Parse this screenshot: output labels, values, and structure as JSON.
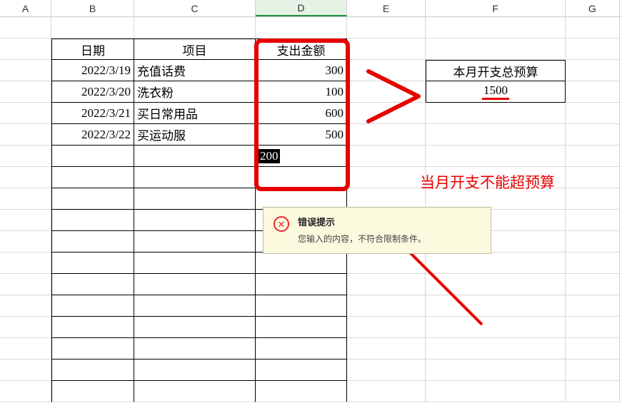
{
  "columns": [
    "A",
    "B",
    "C",
    "D",
    "E",
    "F",
    "G"
  ],
  "headers": {
    "date": "日期",
    "item": "项目",
    "amount": "支出金额"
  },
  "rows": [
    {
      "date": "2022/3/19",
      "item": "充值话费",
      "amount": "300"
    },
    {
      "date": "2022/3/20",
      "item": "洗衣粉",
      "amount": "100"
    },
    {
      "date": "2022/3/21",
      "item": "买日常用品",
      "amount": "600"
    },
    {
      "date": "2022/3/22",
      "item": "买运动服",
      "amount": "500"
    }
  ],
  "editing_value": "200",
  "budget": {
    "label": "本月开支总预算",
    "value": "1500"
  },
  "annotation": "当月开支不能超预算",
  "error": {
    "title": "错误提示",
    "message": "您输入的内容，不符合限制条件。"
  },
  "chart_data": {
    "type": "table",
    "title": "支出金额",
    "columns": [
      "日期",
      "项目",
      "支出金额"
    ],
    "rows": [
      [
        "2022/3/19",
        "充值话费",
        300
      ],
      [
        "2022/3/20",
        "洗衣粉",
        100
      ],
      [
        "2022/3/21",
        "买日常用品",
        600
      ],
      [
        "2022/3/22",
        "买运动服",
        500
      ]
    ],
    "budget_label": "本月开支总预算",
    "budget_value": 1500,
    "entered_value": 200
  }
}
